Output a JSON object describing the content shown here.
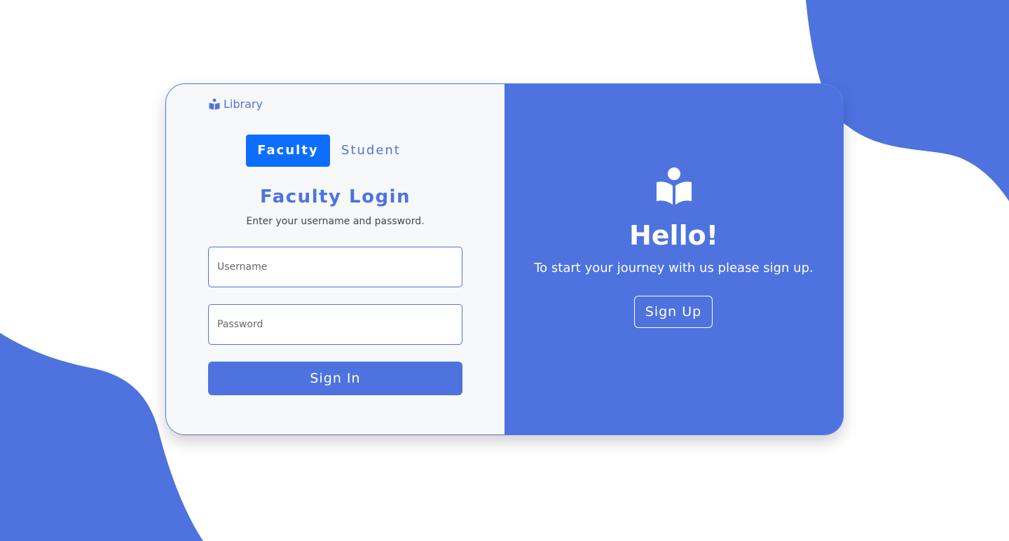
{
  "brand": {
    "name": "Library",
    "icon": "reading-person-icon"
  },
  "tabs": [
    {
      "label": "Faculty",
      "active": true
    },
    {
      "label": "Student",
      "active": false
    }
  ],
  "login": {
    "title": "Faculty Login",
    "subtitle": "Enter your username and password.",
    "username_placeholder": "Username",
    "password_placeholder": "Password",
    "submit_label": "Sign In"
  },
  "welcome": {
    "icon": "reading-person-icon",
    "title": "Hello!",
    "text": "To start your journey with us please sign up.",
    "button_label": "Sign Up"
  },
  "colors": {
    "accent": "#4e73df",
    "active_tab": "#0d6efd",
    "panel_bg": "#f6f8fa",
    "page_bg": "#ffffff"
  }
}
